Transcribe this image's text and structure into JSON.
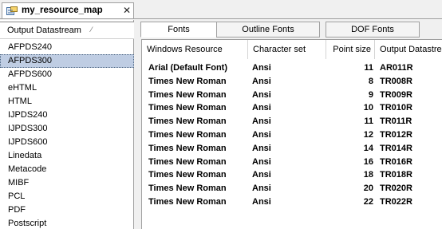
{
  "document_tab": {
    "title": "my_resource_map",
    "close_glyph": "✕",
    "icon": "resource-map-icon"
  },
  "left_panel": {
    "header": "Output Datastream",
    "items": [
      {
        "label": "AFPDS240",
        "selected": false
      },
      {
        "label": "AFPDS300",
        "selected": true
      },
      {
        "label": "AFPDS600",
        "selected": false
      },
      {
        "label": "eHTML",
        "selected": false
      },
      {
        "label": "HTML",
        "selected": false
      },
      {
        "label": "IJPDS240",
        "selected": false
      },
      {
        "label": "IJPDS300",
        "selected": false
      },
      {
        "label": "IJPDS600",
        "selected": false
      },
      {
        "label": "Linedata",
        "selected": false
      },
      {
        "label": "Metacode",
        "selected": false
      },
      {
        "label": "MIBF",
        "selected": false
      },
      {
        "label": "PCL",
        "selected": false
      },
      {
        "label": "PDF",
        "selected": false
      },
      {
        "label": "Postscript",
        "selected": false
      }
    ]
  },
  "inner_tabs": [
    {
      "label": "Fonts",
      "active": true
    },
    {
      "label": "Outline Fonts",
      "active": false
    },
    {
      "label": "DOF Fonts",
      "active": false
    }
  ],
  "table": {
    "columns": [
      "Windows Resource",
      "Character set",
      "Point size",
      "Output Datastream"
    ],
    "rows": [
      [
        "Arial  (Default Font)",
        "Ansi",
        "11",
        "AR011R"
      ],
      [
        "Times New Roman",
        "Ansi",
        "8",
        "TR008R"
      ],
      [
        "Times New Roman",
        "Ansi",
        "9",
        "TR009R"
      ],
      [
        "Times New Roman",
        "Ansi",
        "10",
        "TR010R"
      ],
      [
        "Times New Roman",
        "Ansi",
        "11",
        "TR011R"
      ],
      [
        "Times New Roman",
        "Ansi",
        "12",
        "TR012R"
      ],
      [
        "Times New Roman",
        "Ansi",
        "14",
        "TR014R"
      ],
      [
        "Times New Roman",
        "Ansi",
        "16",
        "TR016R"
      ],
      [
        "Times New Roman",
        "Ansi",
        "18",
        "TR018R"
      ],
      [
        "Times New Roman",
        "Ansi",
        "20",
        "TR020R"
      ],
      [
        "Times New Roman",
        "Ansi",
        "22",
        "TR022R"
      ]
    ]
  },
  "colors": {
    "selection": "#bfcde3",
    "border": "#a0a0a0"
  }
}
